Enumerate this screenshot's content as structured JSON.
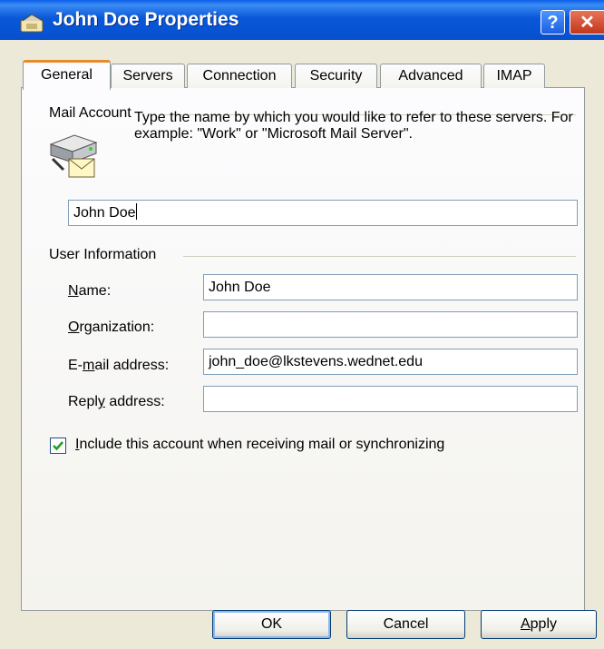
{
  "window": {
    "title": "John Doe Properties",
    "help_glyph": "?",
    "close_glyph": "✕"
  },
  "tabs": [
    "General",
    "Servers",
    "Connection",
    "Security",
    "Advanced",
    "IMAP"
  ],
  "active_tab": "General",
  "mail_account": {
    "group_label": "Mail Account",
    "description": "Type the name by which you would like to refer to these servers.  For example: \"Work\" or \"Microsoft Mail Server\".",
    "account_name_value": "John Doe"
  },
  "user_information": {
    "group_label": "User Information",
    "fields": [
      {
        "label": "Name:",
        "value": "John Doe"
      },
      {
        "label": "Organization:",
        "value": ""
      },
      {
        "label": "E-mail address:",
        "value": "john_doe@lkstevens.wednet.edu"
      },
      {
        "label": "Reply address:",
        "value": ""
      }
    ]
  },
  "include_account": {
    "label": "Include this account when receiving mail or synchronizing",
    "checked": true
  },
  "buttons": {
    "ok": "OK",
    "cancel": "Cancel",
    "apply": "Apply"
  },
  "colors": {
    "titlebar": "#0a57d8",
    "dialog_bg": "#ece9d8",
    "tab_highlight": "#e68b2c"
  },
  "icons": [
    "outlook-properties-icon",
    "help-icon",
    "close-icon",
    "mail-server-icon",
    "checkmark-icon"
  ]
}
